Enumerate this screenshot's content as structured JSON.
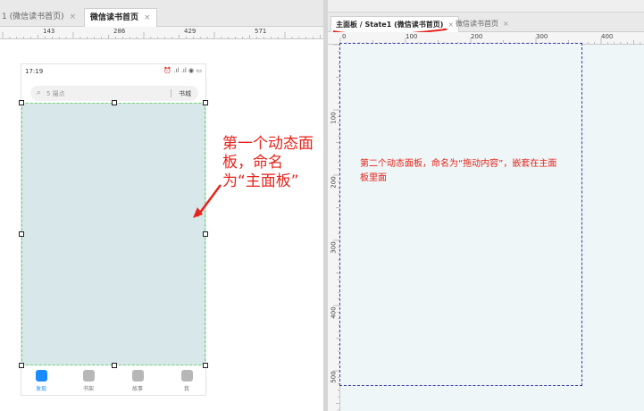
{
  "left_tabs": [
    {
      "label": "1 (微信读书首页)",
      "close": "×",
      "active": false
    },
    {
      "label": "微信读书首页",
      "close": "×",
      "active": true
    }
  ],
  "left_ruler": {
    "labels": [
      "143",
      "286",
      "429",
      "571"
    ]
  },
  "phone": {
    "time": "17:19",
    "signal": "⏰ .ıl .ıl ◉ ▭",
    "search_placeholder": "5 撮点",
    "search_action": "书城",
    "nav": [
      {
        "label": "发现",
        "active": true
      },
      {
        "label": "书架",
        "active": false
      },
      {
        "label": "故事",
        "active": false
      },
      {
        "label": "我",
        "active": false
      }
    ]
  },
  "annotation_left": "第一个动态面板，命名为“主面板”",
  "right_tabs": [
    {
      "label": "主面板 / State1 (微信读书首页)",
      "close": "×",
      "active": true
    },
    {
      "label": "微信读书首页",
      "close": "×",
      "active": false
    }
  ],
  "right_ruler_h": {
    "labels": [
      "0",
      "100",
      "200",
      "300",
      "400"
    ]
  },
  "right_ruler_v": {
    "labels": [
      "100",
      "200",
      "300",
      "400",
      "500"
    ]
  },
  "annotation_right": "第二个动态面板，命名为“拖动内容”，嵌套在主面板里面",
  "colors": {
    "accent": "#1a8cff",
    "annotation": "#e8231b",
    "panel_fill": "#d8e8ea",
    "selection_border": "#6dd36d"
  }
}
